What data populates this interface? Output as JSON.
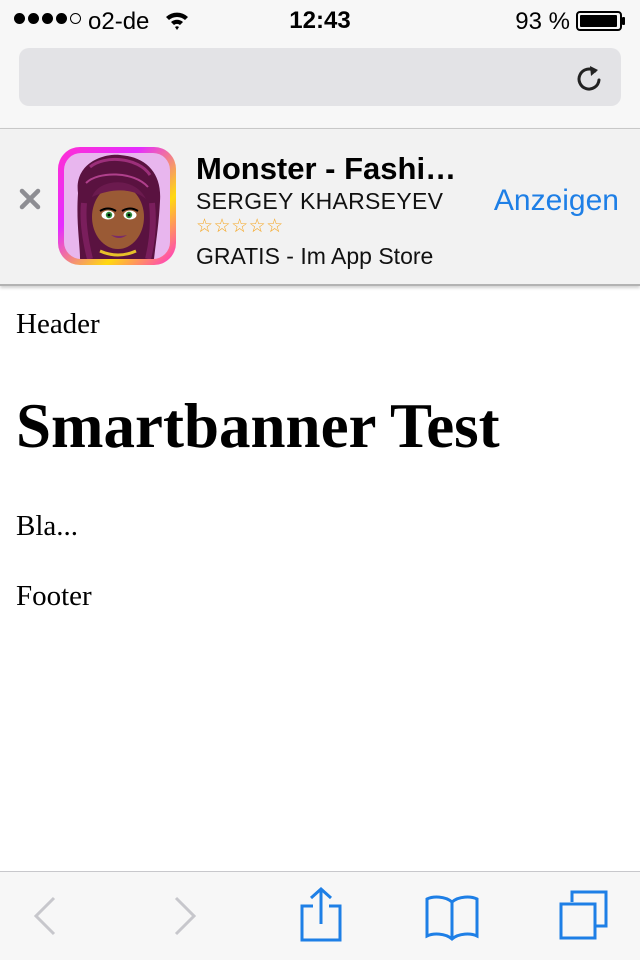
{
  "status_bar": {
    "carrier": "o2-de",
    "time": "12:43",
    "battery": "93 %",
    "signal_bars": 4,
    "signal_max": 5
  },
  "url_bar": {
    "value": "",
    "reload_icon": "reload-icon"
  },
  "smart_banner": {
    "close_icon": "close-icon",
    "app_icon": "app-icon",
    "app_name": "Monster - Fashi…",
    "developer": "SERGEY KHARSEYEV",
    "stars": "☆☆☆☆☆",
    "rating": 0,
    "price": "GRATIS - Im App Store",
    "action_label": "Anzeigen",
    "accent_color": "#1e7fe6",
    "star_color": "#f5a623"
  },
  "page": {
    "header": "Header",
    "title": "Smartbanner Test",
    "body": "Bla...",
    "footer": "Footer"
  },
  "toolbar": {
    "back_icon": "back-chevron-icon",
    "forward_icon": "forward-chevron-icon",
    "share_icon": "share-icon",
    "bookmarks_icon": "bookmarks-icon",
    "tabs_icon": "tabs-icon",
    "accent_color": "#1e7fe6",
    "disabled_color": "#c7c7cc"
  }
}
